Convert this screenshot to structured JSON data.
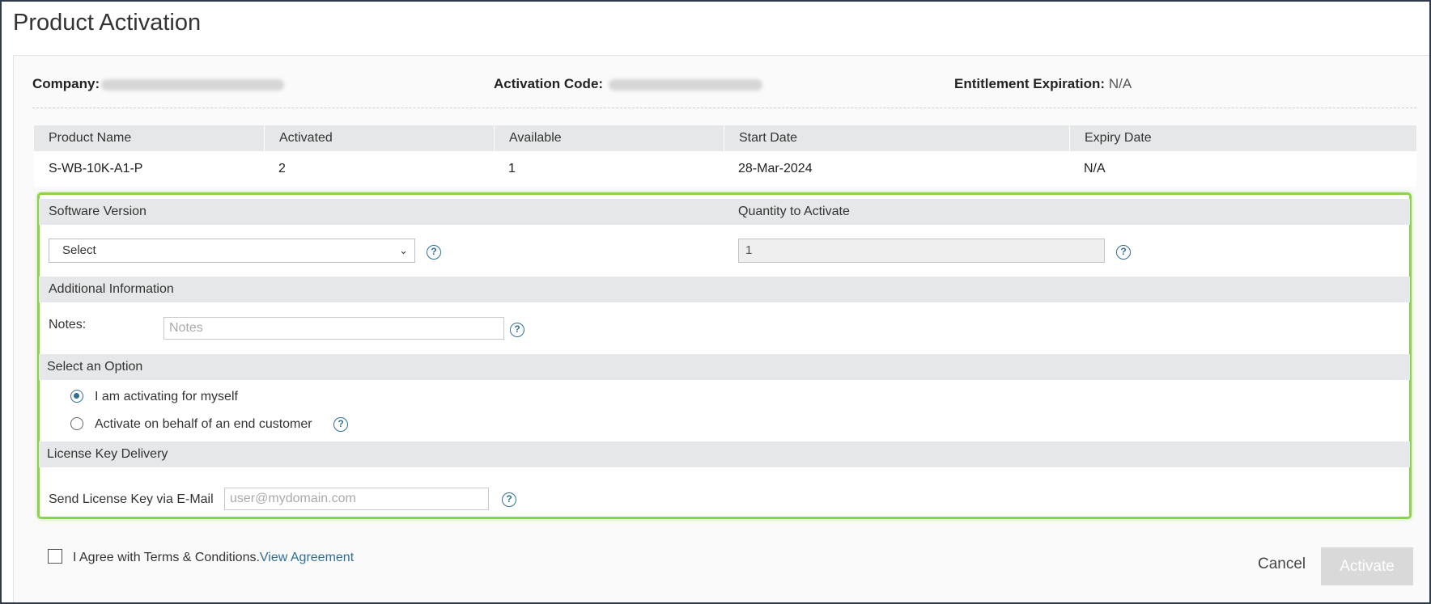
{
  "page": {
    "title": "Product Activation"
  },
  "info": {
    "company_label": "Company:",
    "activation_code_label": "Activation Code:",
    "expiration_label": "Entitlement Expiration:",
    "expiration_value": "N/A"
  },
  "table": {
    "headers": [
      "Product Name",
      "Activated",
      "Available",
      "Start Date",
      "Expiry Date"
    ],
    "rows": [
      [
        "S-WB-10K-A1-P",
        "2",
        "1",
        "28-Mar-2024",
        "N/A"
      ]
    ]
  },
  "software": {
    "section_label": "Software Version",
    "select_value": "Select"
  },
  "quantity": {
    "section_label": "Quantity to Activate",
    "value": "1"
  },
  "additional": {
    "section_label": "Additional Information",
    "notes_label": "Notes:",
    "notes_placeholder": "Notes"
  },
  "option": {
    "section_label": "Select an Option",
    "radio_self": "I am activating for myself",
    "radio_customer": "Activate on behalf of an end customer",
    "selected": "self"
  },
  "delivery": {
    "section_label": "License Key Delivery",
    "email_label": "Send License Key via E-Mail",
    "email_placeholder": "user@mydomain.com"
  },
  "footer": {
    "terms_text": "I Agree with Terms & Conditions.",
    "terms_link": "View Agreement",
    "cancel_label": "Cancel",
    "activate_label": "Activate"
  },
  "icons": {
    "help": "help-circle-icon",
    "chevron": "chevron-down-icon"
  },
  "colors": {
    "accent": "#2f6f95",
    "highlight": "#8cd24a",
    "header_bg": "#e6e7e8",
    "disabled_button": "#d9d9d9"
  }
}
